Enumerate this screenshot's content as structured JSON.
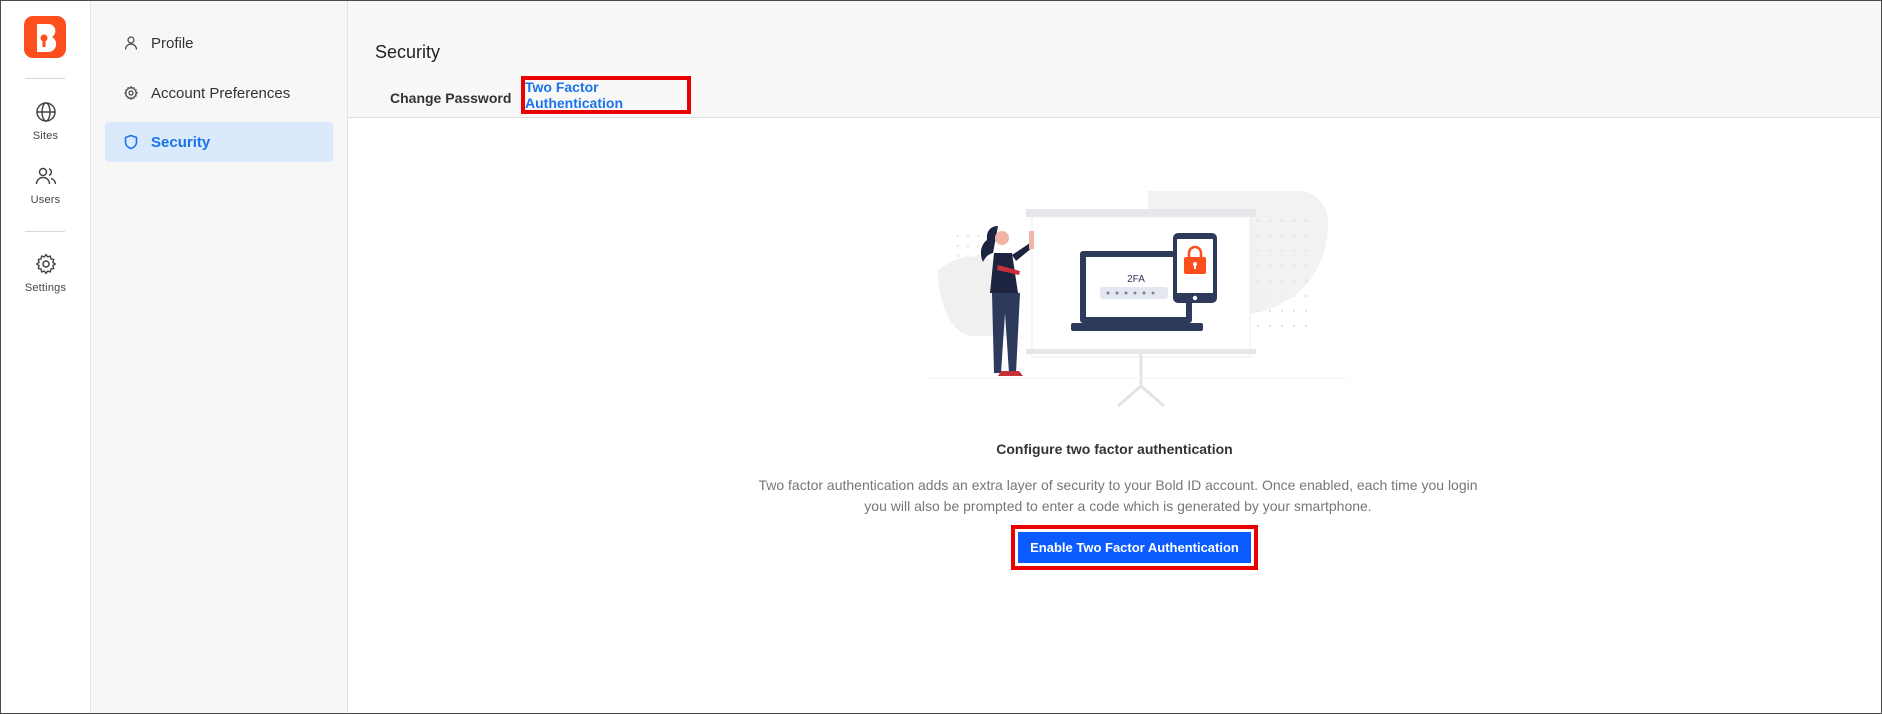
{
  "rail": {
    "items": [
      {
        "label": "Sites",
        "icon": "globe-icon"
      },
      {
        "label": "Users",
        "icon": "users-icon"
      },
      {
        "label": "Settings",
        "icon": "gear-icon"
      }
    ]
  },
  "subnav": {
    "items": [
      {
        "label": "Profile",
        "icon": "person-icon"
      },
      {
        "label": "Account Preferences",
        "icon": "gear-icon"
      },
      {
        "label": "Security",
        "icon": "shield-icon",
        "active": true
      }
    ]
  },
  "main": {
    "title": "Security",
    "tabs": [
      {
        "label": "Change Password"
      },
      {
        "label": "Two Factor Authentication",
        "active": true
      }
    ],
    "illustration": {
      "screen_text": "2FA"
    },
    "heading": "Configure two factor authentication",
    "description": "Two factor authentication adds an extra layer of security to your Bold ID account. Once enabled, each time you login you will also be prompted to enter a code which is generated by your smartphone.",
    "enable_button": "Enable Two Factor Authentication"
  },
  "colors": {
    "brand": "#fc4f1d",
    "accent": "#1a73e8",
    "primary_button": "#0b5bff",
    "highlight_box": "#ea0000"
  }
}
